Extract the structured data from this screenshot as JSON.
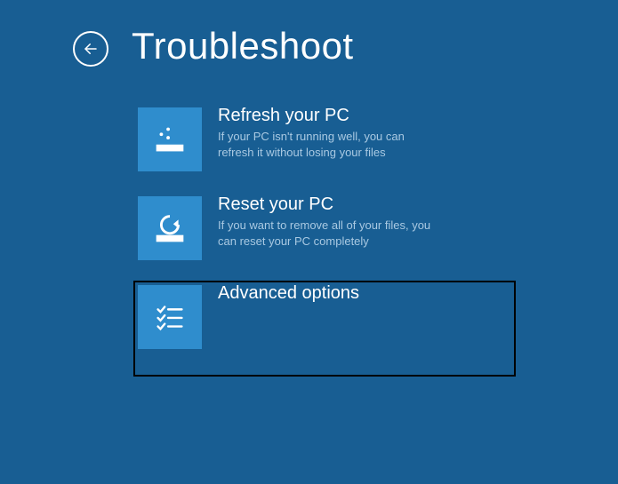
{
  "header": {
    "title": "Troubleshoot"
  },
  "options": [
    {
      "title": "Refresh your PC",
      "desc": "If your PC isn't running well, you can refresh it without losing your files"
    },
    {
      "title": "Reset your PC",
      "desc": "If you want to remove all of your files, you can reset your PC completely"
    },
    {
      "title": "Advanced options",
      "desc": ""
    }
  ]
}
